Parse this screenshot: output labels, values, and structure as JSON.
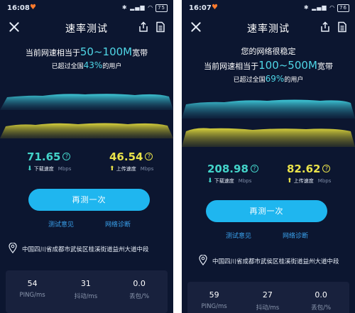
{
  "screens": {
    "left": {
      "status": {
        "time": "16:08",
        "battery": "75"
      },
      "title": "速率测试",
      "message": {
        "line_prefix": "当前网速相当于",
        "bandwidth": "50~100M",
        "line_suffix": "宽带",
        "beat_prefix": "已超过全国",
        "beat_percent": "43%",
        "beat_suffix": "的用户"
      },
      "download": {
        "value": "71.65",
        "label": "下载速度",
        "unit": "Mbps"
      },
      "upload": {
        "value": "46.54",
        "label": "上传速度",
        "unit": "Mbps"
      },
      "retest_label": "再测一次",
      "links": {
        "feedback": "测试意见",
        "diagnosis": "网络诊断"
      },
      "location": "中国四川省成都市武侯区桂溪街道益州大道中段",
      "stats": [
        {
          "value": "54",
          "label": "PING/ms"
        },
        {
          "value": "31",
          "label": "抖动/ms"
        },
        {
          "value": "0.0",
          "label": "丢包/%"
        }
      ]
    },
    "right": {
      "status": {
        "time": "16:07",
        "battery": "76"
      },
      "title": "速率测试",
      "message": {
        "stable": "您的网络很稳定",
        "line_prefix": "当前网速相当于",
        "bandwidth": "100~500M",
        "line_suffix": "宽带",
        "beat_prefix": "已超过全国",
        "beat_percent": "69%",
        "beat_suffix": "的用户"
      },
      "download": {
        "value": "208.98",
        "label": "下载速度",
        "unit": "Mbps"
      },
      "upload": {
        "value": "82.62",
        "label": "上传速度",
        "unit": "Mbps"
      },
      "retest_label": "再测一次",
      "links": {
        "feedback": "测试意见",
        "diagnosis": "网络诊断"
      },
      "location": "中国四川省成都市武侯区桂溪街道益州大道中段",
      "stats": [
        {
          "value": "59",
          "label": "PING/ms"
        },
        {
          "value": "27",
          "label": "抖动/ms"
        },
        {
          "value": "0.0",
          "label": "丢包/%"
        }
      ]
    }
  },
  "colors": {
    "background": "#0c1630",
    "download": "#43d3c9",
    "upload": "#e9e24a",
    "button": "#1fb6ef",
    "link": "#3aa2ee",
    "highlight": "#4fd6e6"
  },
  "icons": [
    "close-icon",
    "share-icon",
    "document-icon",
    "question-icon",
    "download-arrow-icon",
    "upload-arrow-icon",
    "location-pin-icon"
  ]
}
